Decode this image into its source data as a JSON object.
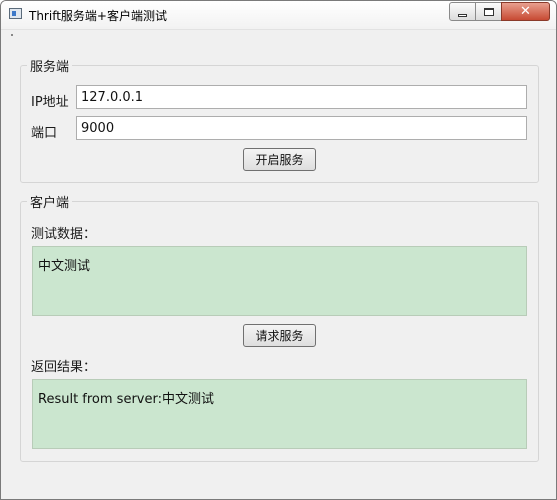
{
  "window": {
    "title": "Thrift服务端+客户端测试",
    "close_color": "#c74a33"
  },
  "server": {
    "legend": "服务端",
    "ip_label": "IP地址",
    "ip_value": "127.0.0.1",
    "port_label": "端口",
    "port_value": "9000",
    "start_button": "开启服务"
  },
  "client": {
    "legend": "客户端",
    "test_data_label": "测试数据：",
    "test_data_value": "中文测试",
    "request_button": "请求服务",
    "result_label": "返回结果：",
    "result_value": "Result from server:中文测试",
    "text_area_color": "#cbe6cf"
  },
  "icons": {
    "app": "app-window-icon",
    "minimize": "minimize-icon",
    "maximize": "maximize-icon",
    "close": "close-icon"
  }
}
